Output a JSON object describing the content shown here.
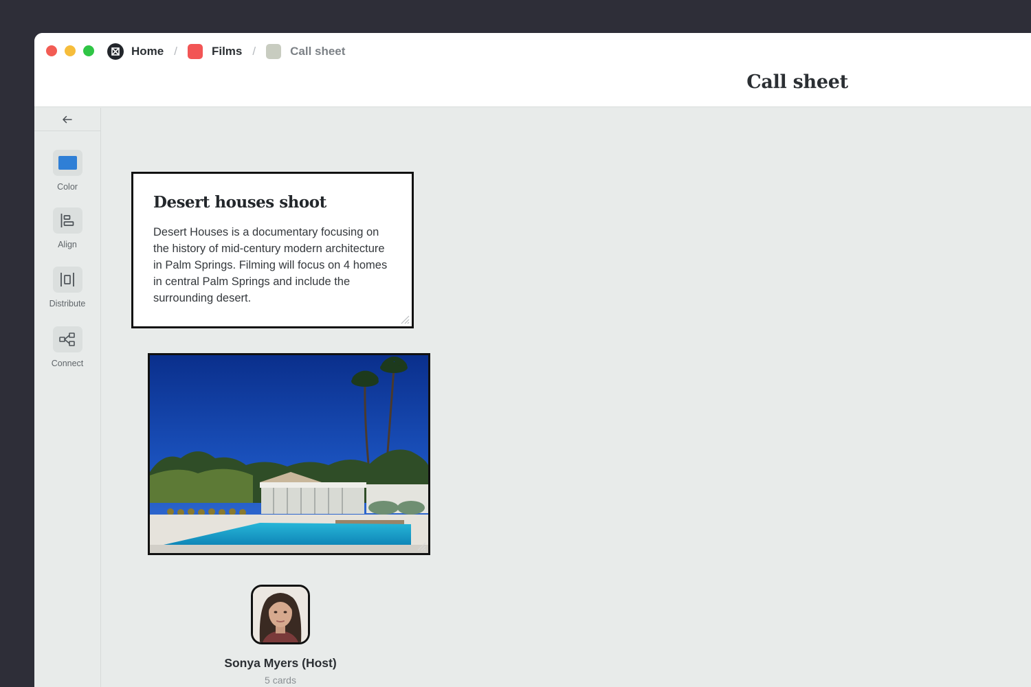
{
  "breadcrumb": {
    "items": [
      {
        "label": "Home",
        "icon": "logo-icon"
      },
      {
        "label": "Films",
        "icon": "red-square-icon",
        "color": "#f25555"
      },
      {
        "label": "Call sheet",
        "icon": "gray-square-icon",
        "color": "#c8ccc0"
      }
    ],
    "separator": "/"
  },
  "page": {
    "title": "Call sheet"
  },
  "sidebar": {
    "back_icon": "arrow-left-icon",
    "tools": [
      {
        "label": "Color",
        "icon": "color-swatch-icon",
        "swatch": "#2f7fd6"
      },
      {
        "label": "Align",
        "icon": "align-left-icon"
      },
      {
        "label": "Distribute",
        "icon": "distribute-icon"
      },
      {
        "label": "Connect",
        "icon": "connect-icon"
      }
    ]
  },
  "cards": {
    "note": {
      "title": "Desert houses shoot",
      "body": "Desert Houses is a documentary focusing on the history of mid-century modern architecture in Palm Springs. Filming will focus on 4 homes in central Palm Springs and include the surrounding desert."
    },
    "image": {
      "alt": "desert-house-pool-photo"
    },
    "person": {
      "name": "Sonya Myers (Host)",
      "subtitle": "5 cards"
    }
  }
}
